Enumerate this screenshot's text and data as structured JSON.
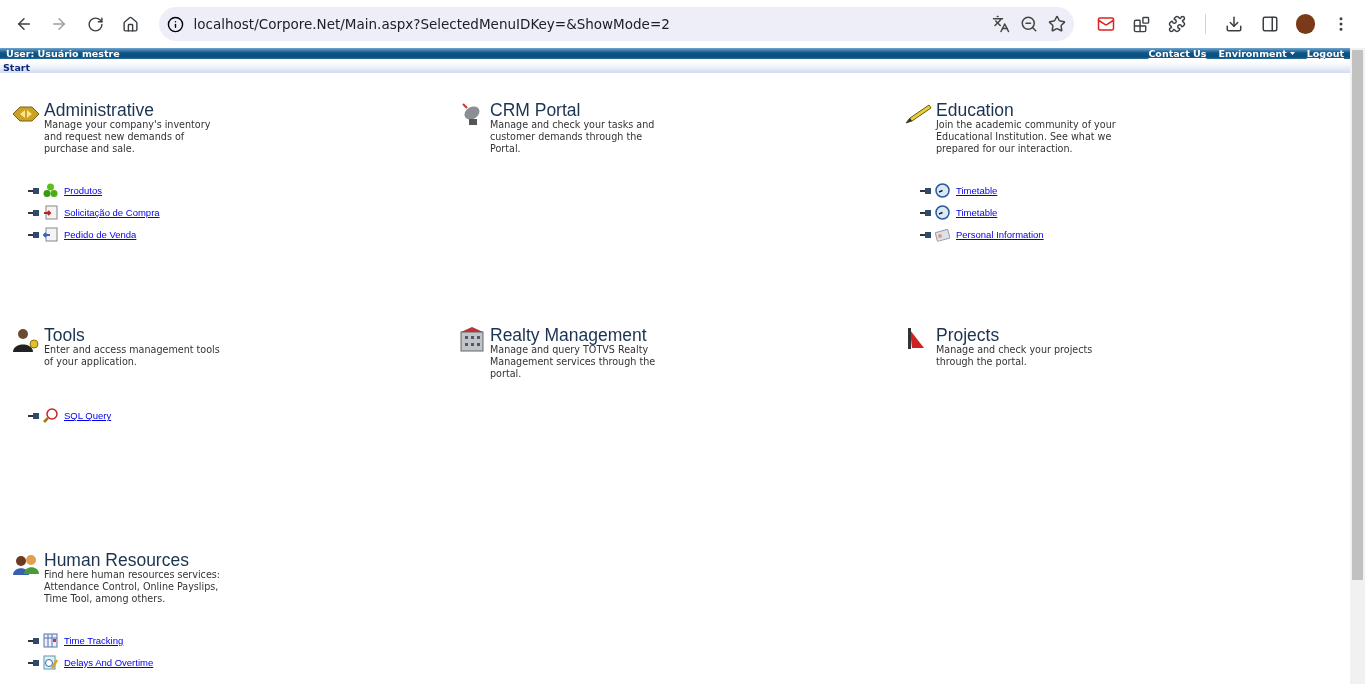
{
  "browser": {
    "url": "localhost/Corpore.Net/Main.aspx?SelectedMenuIDKey=&ShowMode=2"
  },
  "header": {
    "user": "User: Usuário mestre",
    "links": [
      {
        "label": "Contact Us",
        "kind": "link"
      },
      {
        "label": "Environment",
        "kind": "menu"
      },
      {
        "label": "Logout",
        "kind": "link"
      }
    ]
  },
  "breadcrumb": "Start",
  "modules": [
    {
      "kind": "admin",
      "title": "Administrative",
      "description": "Manage your company's inventory and request new demands of purchase and sale.",
      "links": [
        {
          "kind": "products",
          "label": "Produtos"
        },
        {
          "kind": "purchase",
          "label": "Solicitação de Compra"
        },
        {
          "kind": "sales",
          "label": "Pedido de Venda"
        }
      ]
    },
    {
      "kind": "crm",
      "title": "CRM Portal",
      "description": "Manage and check your tasks and customer demands through the Portal."
    },
    {
      "kind": "education",
      "title": "Education",
      "description": "Join the academic community of your Educational Institution. See what we prepared for our interaction.",
      "links": [
        {
          "kind": "clock",
          "label": "Timetable"
        },
        {
          "kind": "clock",
          "label": "Timetable"
        },
        {
          "kind": "card",
          "label": "Personal Information"
        }
      ]
    },
    {
      "kind": "tools",
      "title": "Tools",
      "description": "Enter and access management tools of your application.",
      "links": [
        {
          "kind": "sql",
          "label": "SQL Query"
        }
      ]
    },
    {
      "kind": "realty",
      "title": "Realty Management",
      "description": "Manage and query TOTVS Realty Management services through the portal."
    },
    {
      "kind": "projects",
      "title": "Projects",
      "description": "Manage and check your projects through the portal."
    },
    {
      "kind": "hr",
      "title": "Human Resources",
      "description": "Find here human resources services: Attendance Control, Online Payslips, Time Tool, among others.",
      "links": [
        {
          "kind": "calendar",
          "label": "Time Tracking"
        },
        {
          "kind": "overtime",
          "label": "Delays And Overtime"
        }
      ]
    }
  ]
}
